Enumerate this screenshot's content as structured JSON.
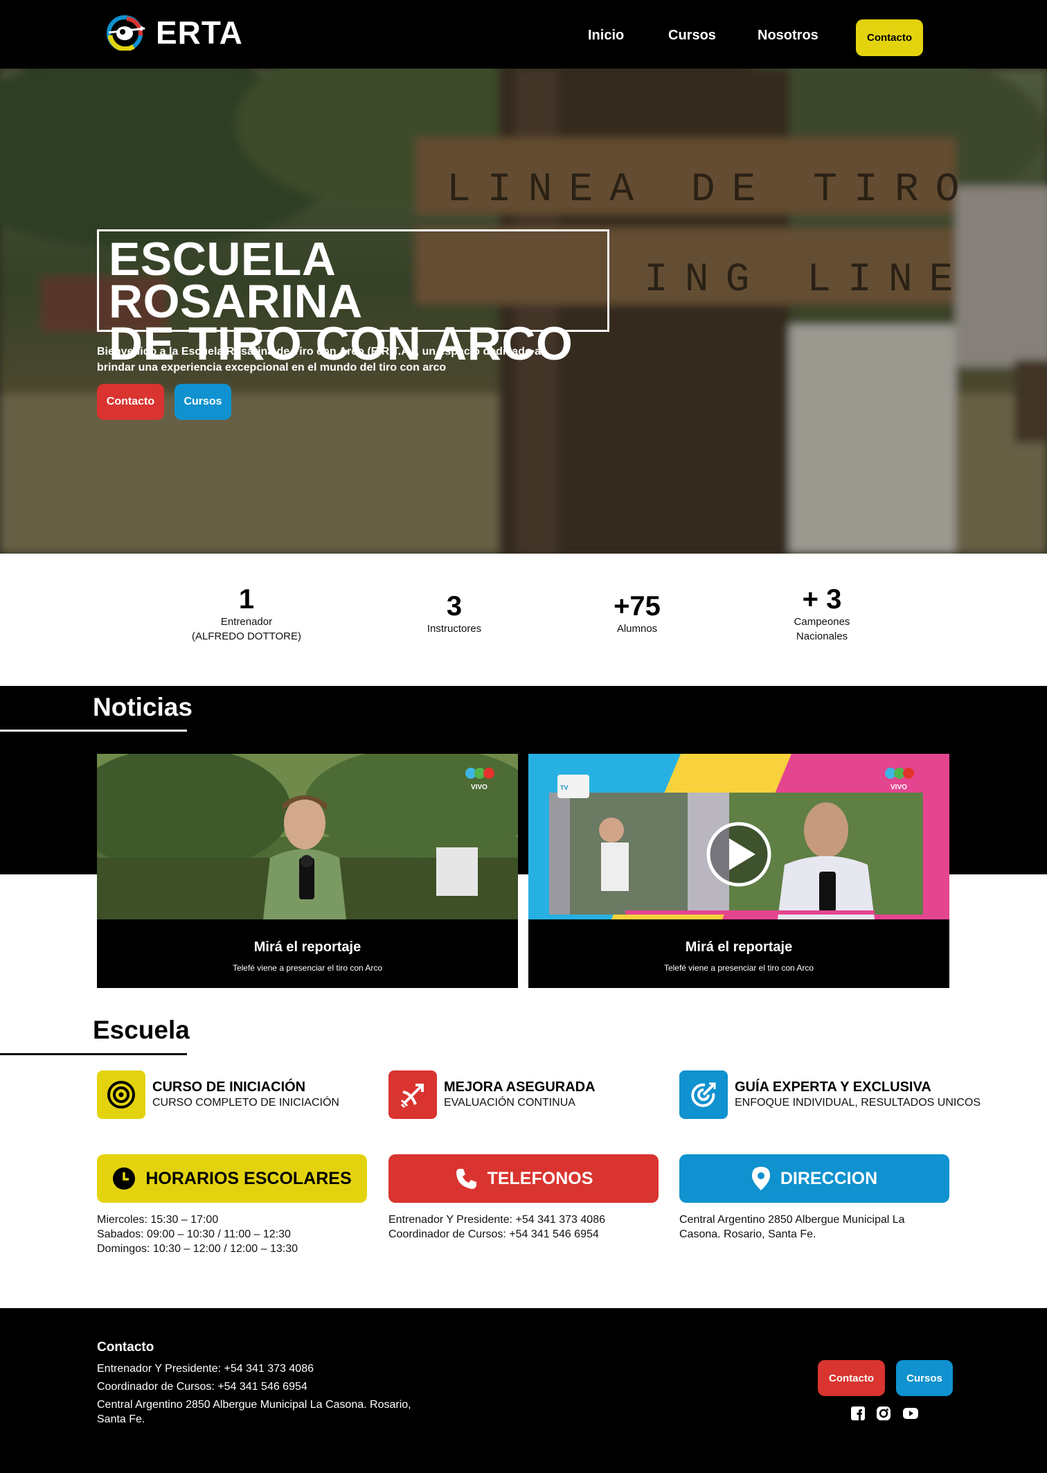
{
  "nav": {
    "logo_text": "ERTA",
    "links": [
      "Inicio",
      "Cursos",
      "Nosotros"
    ],
    "cta": "Contacto"
  },
  "hero": {
    "title_line1": "ESCUELA ROSARINA",
    "title_line2": "DE TIRO CON ARCO",
    "subtitle": "Bienvenido a la Escuela Rosarina de Tiro con Arco (E.R.T.A.), un espacio dedicado a brindar una experiencia excepcional en el mundo del tiro con arco",
    "btn_contacto": "Contacto",
    "btn_cursos": "Cursos",
    "sign1": "LINEA DE TIRO",
    "sign2": "ING LINE"
  },
  "stats": [
    {
      "value": "1",
      "label1": "Entrenador",
      "label2": "(ALFREDO DOTTORE)"
    },
    {
      "value": "3",
      "label1": "Instructores",
      "label2": ""
    },
    {
      "value": "+75",
      "label1": "Alumnos",
      "label2": ""
    },
    {
      "value": "+ 3",
      "label1": "Campeones",
      "label2": "Nacionales"
    }
  ],
  "news": {
    "title": "Noticias",
    "cards": [
      {
        "title": "Mirá el reportaje",
        "subtitle": "Telefé viene a presenciar el tiro con Arco",
        "badge": "VIVO"
      },
      {
        "title": "Mirá el reportaje",
        "subtitle": "Telefé viene a presenciar el tiro con Arco",
        "badge": "VIVO"
      }
    ]
  },
  "school": {
    "title": "Escuela",
    "features": [
      {
        "title": "CURSO DE INICIACIÓN",
        "subtitle": "CURSO COMPLETO DE INICIACIÓN",
        "icon": "target-icon",
        "color": "#e3d30f"
      },
      {
        "title": "MEJORA ASEGURADA",
        "subtitle": "EVALUACIÓN CONTINUA",
        "icon": "archery-icon",
        "color": "#d9342f"
      },
      {
        "title": "GUÍA EXPERTA Y EXCLUSIVA",
        "subtitle": "ENFOQUE INDIVIDUAL, RESULTADOS UNICOS",
        "icon": "bullseye-arrow-icon",
        "color": "#0f92cf"
      }
    ],
    "info": [
      {
        "label": "HORARIOS ESCOLARES",
        "icon": "clock-icon",
        "color": "#e3d30f",
        "lines": [
          "Miercoles: 15:30 – 17:00",
          "Sabados: 09:00 – 10:30 / 11:00 – 12:30",
          "Domingos: 10:30 – 12:00 / 12:00 – 13:30"
        ]
      },
      {
        "label": "TELEFONOS",
        "icon": "phone-icon",
        "color": "#d9342f",
        "lines": [
          "Entrenador Y Presidente: +54 341 373 4086",
          "Coordinador de Cursos: +54 341 546 6954"
        ]
      },
      {
        "label": "DIRECCION",
        "icon": "location-pin-icon",
        "color": "#0f92cf",
        "lines": [
          "Central Argentino 2850 Albergue Municipal La Casona. Rosario, Santa Fe."
        ]
      }
    ]
  },
  "footer": {
    "title": "Contacto",
    "line1": "Entrenador Y Presidente: +54 341 373 4086",
    "line2": "Coordinador de Cursos: +54 341 546 6954",
    "line3": "Central Argentino 2850 Albergue Municipal La Casona. Rosario, Santa Fe.",
    "btn_contacto": "Contacto",
    "btn_cursos": "Cursos",
    "social": [
      "facebook-icon",
      "instagram-icon",
      "youtube-icon"
    ]
  },
  "colors": {
    "yellow": "#e3d30f",
    "red": "#d9342f",
    "blue": "#0f92cf",
    "black": "#000000"
  }
}
